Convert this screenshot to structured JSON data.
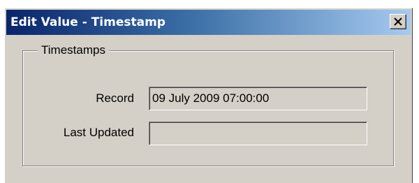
{
  "window": {
    "title": "Edit Value - Timestamp",
    "close_icon": "close-icon"
  },
  "group": {
    "label": "Timestamps"
  },
  "fields": {
    "record": {
      "label": "Record",
      "value": "09 July 2009 07:00:00"
    },
    "last_updated": {
      "label": "Last Updated",
      "value": ""
    }
  },
  "colors": {
    "title_bar_start": "#0a246a",
    "title_bar_end": "#a6caf0",
    "dialog_face": "#d4d0c8"
  }
}
